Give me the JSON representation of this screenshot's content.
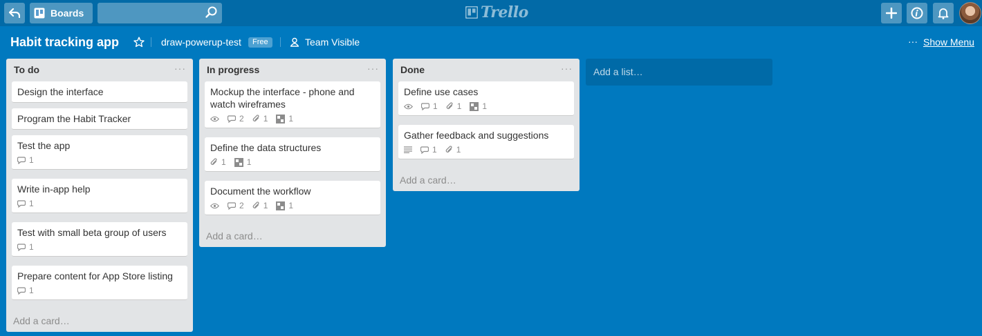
{
  "header": {
    "boards_label": "Boards",
    "search_placeholder": "",
    "logo_text": "Trello"
  },
  "board": {
    "title": "Habit tracking app",
    "org": "draw-powerup-test",
    "org_badge": "Free",
    "visibility": "Team Visible",
    "menu_dots": "···",
    "show_menu": "Show Menu"
  },
  "lists": [
    {
      "title": "To do",
      "add_card": "Add a card…",
      "cards": [
        {
          "title": "Design the interface"
        },
        {
          "title": "Program the Habit Tracker"
        },
        {
          "title": "Test the app",
          "comments": "1"
        },
        {
          "title": "Write in-app help",
          "comments": "1"
        },
        {
          "title": "Test with small beta group of users",
          "comments": "1"
        },
        {
          "title": "Prepare content for App Store listing",
          "comments": "1"
        }
      ]
    },
    {
      "title": "In progress",
      "add_card": "Add a card…",
      "cards": [
        {
          "title": "Mockup the interface - phone and watch wireframes",
          "comments": "2",
          "attachments": "1",
          "checklist": "1"
        },
        {
          "title": "Define the data structures",
          "attachments": "1",
          "checklist": "1"
        },
        {
          "title": "Document the workflow",
          "comments": "2",
          "attachments": "1",
          "checklist": "1"
        }
      ]
    },
    {
      "title": "Done",
      "add_card": "Add a card…",
      "cards": [
        {
          "title": "Define use cases",
          "comments": "1",
          "attachments": "1",
          "checklist": "1"
        },
        {
          "title": "Gather feedback and suggestions",
          "comments": "1",
          "attachments": "1"
        }
      ]
    }
  ],
  "add_list": "Add a list…",
  "list_menu": "···",
  "colors": {
    "board_bg": "#0079bf",
    "header_bg": "#026aa7",
    "list_bg": "#e2e4e6"
  }
}
